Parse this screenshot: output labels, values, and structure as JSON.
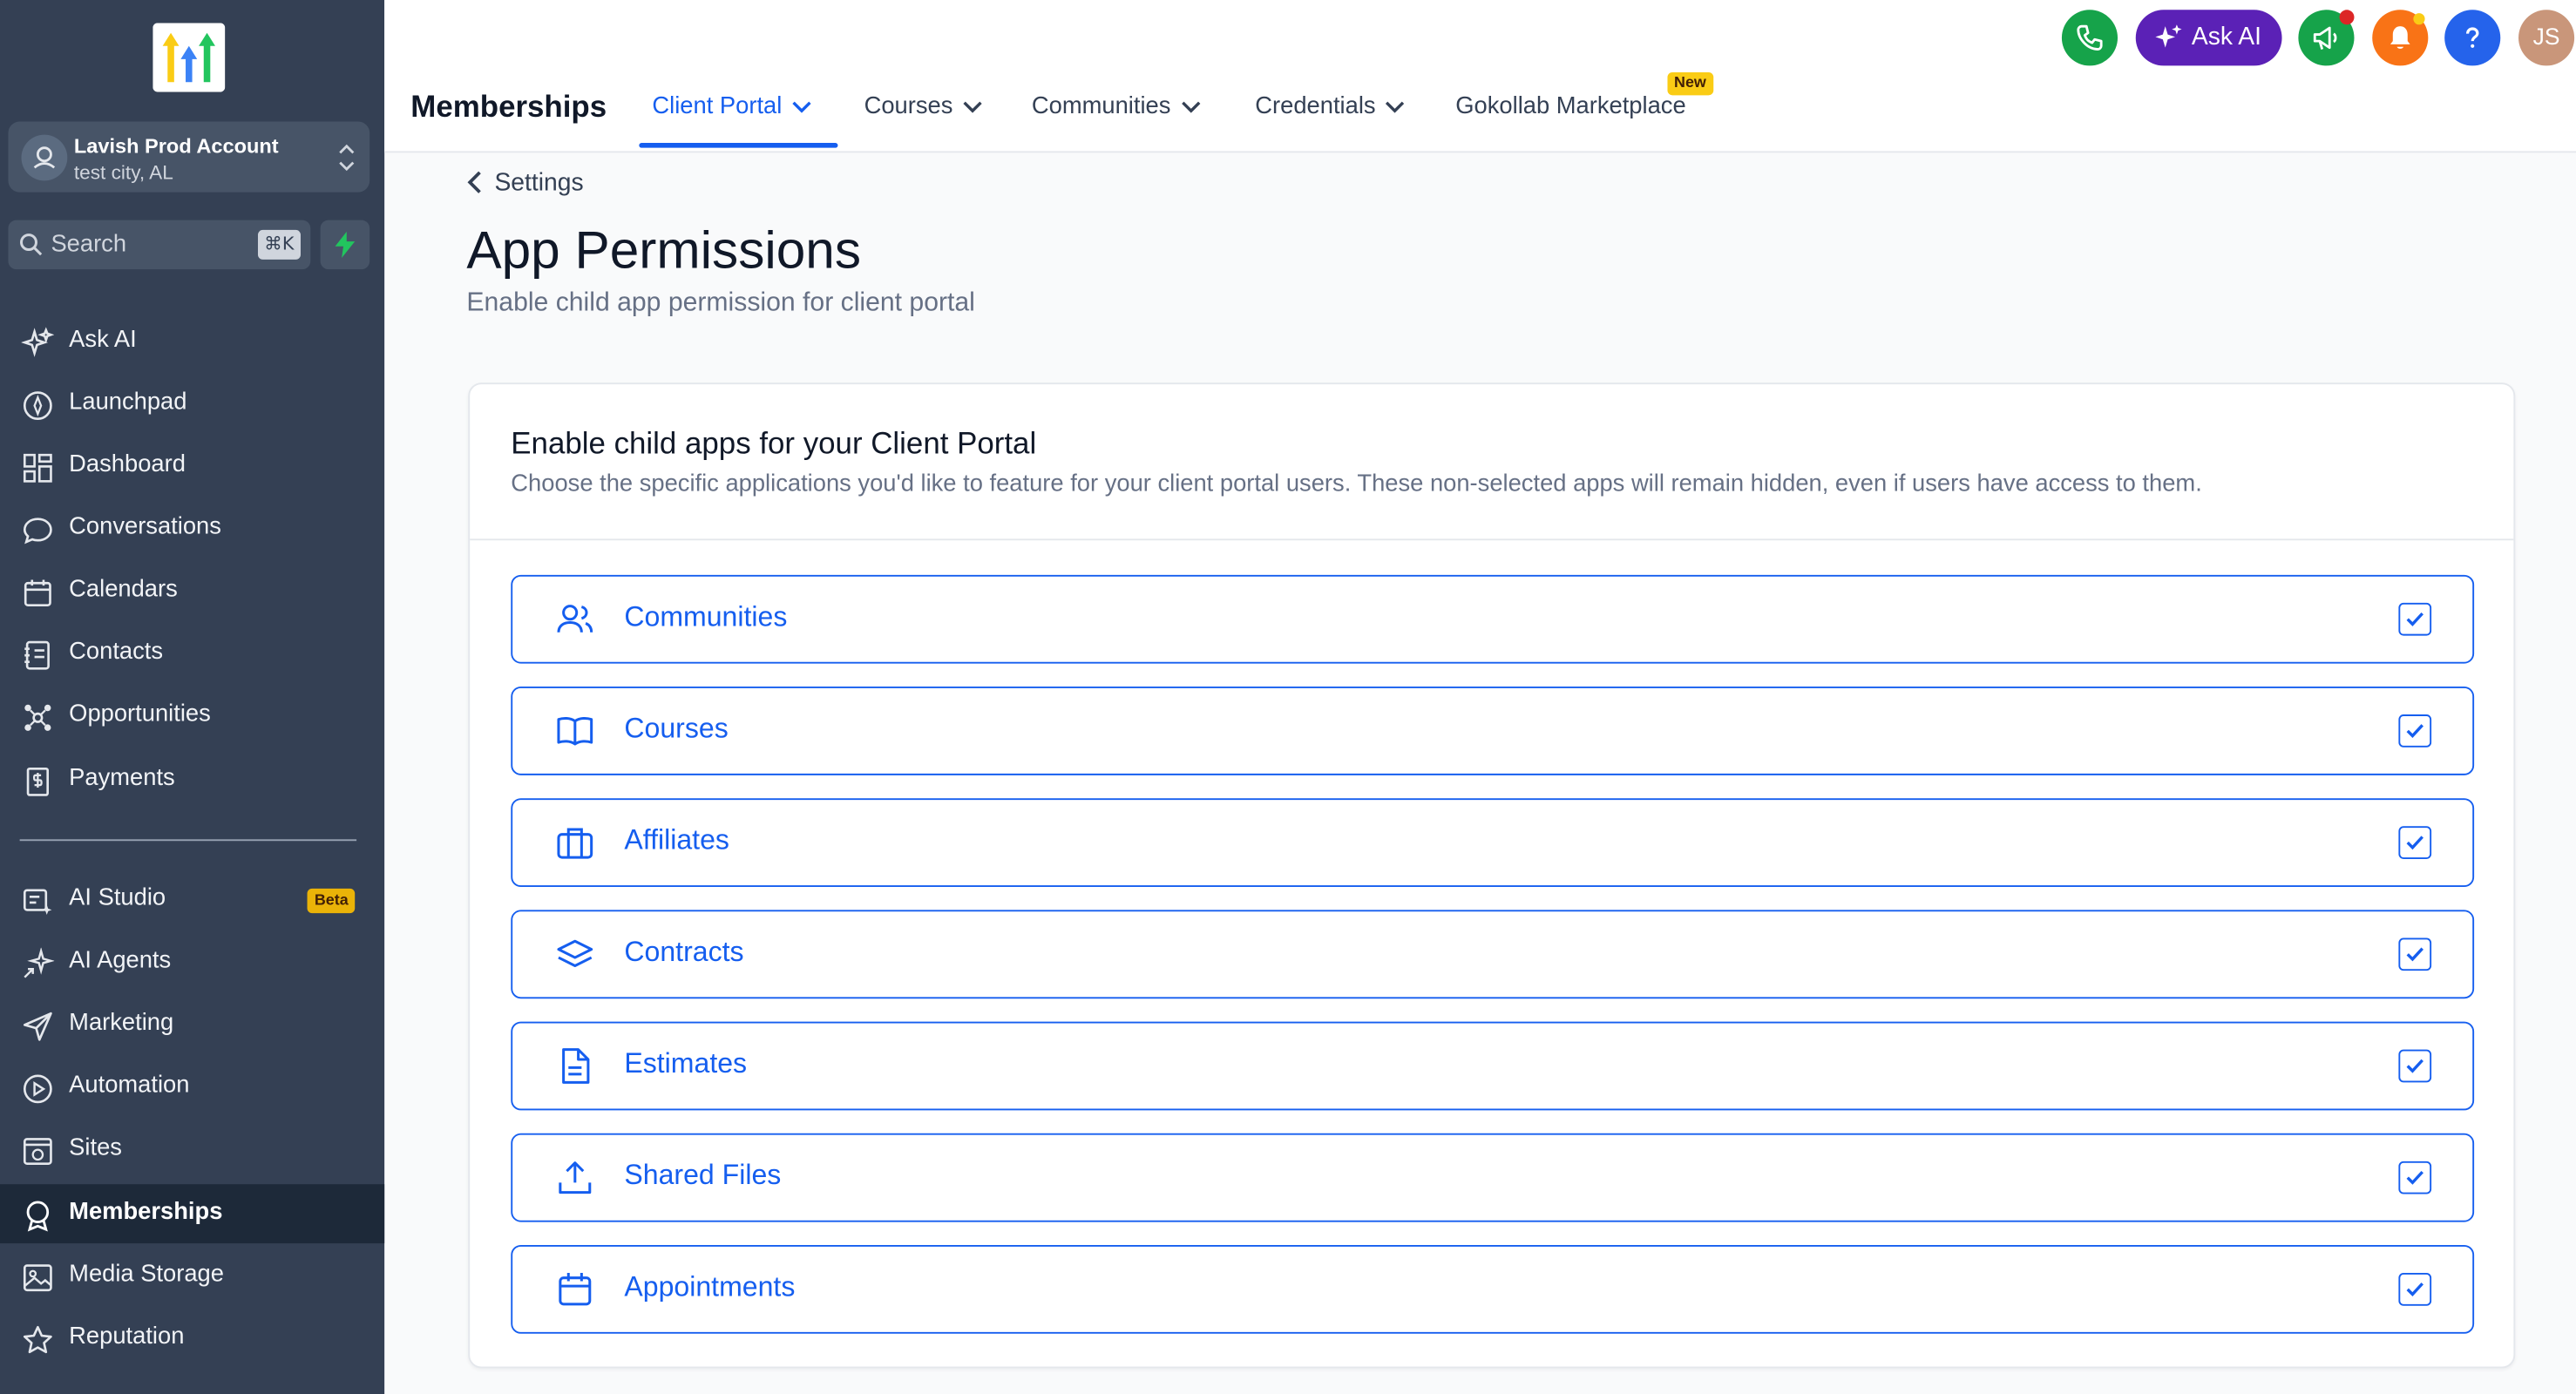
{
  "sidebar": {
    "account": {
      "name": "Lavish Prod Account",
      "location": "test city, AL"
    },
    "search": {
      "placeholder": "Search",
      "shortcut": "⌘K"
    },
    "items": [
      {
        "label": "Ask AI",
        "icon": "sparkles-icon"
      },
      {
        "label": "Launchpad",
        "icon": "rocket-icon"
      },
      {
        "label": "Dashboard",
        "icon": "dashboard-icon"
      },
      {
        "label": "Conversations",
        "icon": "chat-icon"
      },
      {
        "label": "Calendars",
        "icon": "calendar-icon"
      },
      {
        "label": "Contacts",
        "icon": "contacts-icon"
      },
      {
        "label": "Opportunities",
        "icon": "opportunities-icon"
      },
      {
        "label": "Payments",
        "icon": "payments-icon"
      }
    ],
    "items2": [
      {
        "label": "AI Studio",
        "icon": "ai-studio-icon",
        "badge": "Beta"
      },
      {
        "label": "AI Agents",
        "icon": "ai-agents-icon"
      },
      {
        "label": "Marketing",
        "icon": "send-icon"
      },
      {
        "label": "Automation",
        "icon": "automation-icon"
      },
      {
        "label": "Sites",
        "icon": "sites-icon"
      },
      {
        "label": "Memberships",
        "icon": "badge-icon",
        "active": true
      },
      {
        "label": "Media Storage",
        "icon": "image-icon"
      },
      {
        "label": "Reputation",
        "icon": "star-icon"
      }
    ]
  },
  "topbar": {
    "title": "Memberships",
    "tabs": [
      {
        "label": "Client Portal",
        "active": true
      },
      {
        "label": "Courses"
      },
      {
        "label": "Communities"
      },
      {
        "label": "Credentials"
      },
      {
        "label": "Gokollab Marketplace",
        "badge": "New"
      }
    ],
    "ask_ai": "Ask AI",
    "avatar_initials": "JS"
  },
  "content": {
    "back_label": "Settings",
    "title": "App Permissions",
    "subtitle": "Enable child app permission for client portal",
    "card_title": "Enable child apps for your Client Portal",
    "card_desc": "Choose the specific applications you'd like to feature for your client portal users. These non-selected apps will remain hidden, even if users have access to them.",
    "apps": [
      {
        "label": "Communities",
        "icon": "users-icon",
        "checked": true
      },
      {
        "label": "Courses",
        "icon": "book-icon",
        "checked": true
      },
      {
        "label": "Affiliates",
        "icon": "briefcase-icon",
        "checked": true
      },
      {
        "label": "Contracts",
        "icon": "layers-icon",
        "checked": true
      },
      {
        "label": "Estimates",
        "icon": "document-icon",
        "checked": true
      },
      {
        "label": "Shared Files",
        "icon": "upload-icon",
        "checked": true
      },
      {
        "label": "Appointments",
        "icon": "calendar-icon",
        "checked": true
      }
    ]
  },
  "colors": {
    "sidebar_bg": "#344054",
    "sidebar_active": "#1d2939",
    "accent": "#155eef",
    "ask_ai_bg": "#5b21b6",
    "phone_bg": "#16a34a",
    "notification_bg": "#f97316",
    "help_bg": "#2563eb"
  }
}
